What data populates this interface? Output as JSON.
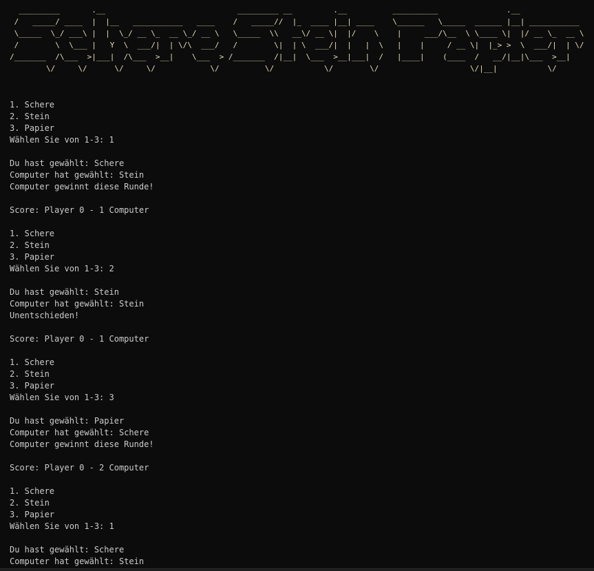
{
  "banner": {
    "ascii_lines": [
      "  _________       .__                             _________ __         .__          __________               .__               ",
      " /   _____/ ____  |  |__   ___________   ____    /   _____//  |_  ____ |__| ____    \\______   \\_____  ______ |__| ___________ ",
      " \\_____  \\_/ ___\\ |  |  \\_/ __ \\_  __ \\_/ __ \\   \\_____  \\\\   __\\/ __ \\|  |/    \\    |     ___/\\__  \\ \\____ \\|  |/ __ \\_  __ \\",
      " /        \\  \\___ |   Y  \\  ___/|  | \\/\\  ___/   /        \\|  | \\  ___/|  |   |  \\   |    |     / __ \\|  |_> >  \\  ___/|  | \\/",
      "/_______  /\\___  >|___|  /\\___  >__|    \\___  > /_______  /|__|  \\___  >__|___|  /   |____|    (____  /   __/|__|\\___  >__|   ",
      "        \\/     \\/      \\/     \\/            \\/          \\/           \\/        \\/                    \\/|__|           \\/       "
    ]
  },
  "output": {
    "lines": [
      "1. Schere",
      "2. Stein",
      "3. Papier",
      "Wählen Sie von 1-3: 1",
      "",
      "Du hast gewählt: Schere",
      "Computer hat gewählt: Stein",
      "Computer gewinnt diese Runde!",
      "",
      "Score: Player 0 - 1 Computer",
      "",
      "1. Schere",
      "2. Stein",
      "3. Papier",
      "Wählen Sie von 1-3: 2",
      "",
      "Du hast gewählt: Stein",
      "Computer hat gewählt: Stein",
      "Unentschieden!",
      "",
      "Score: Player 0 - 1 Computer",
      "",
      "1. Schere",
      "2. Stein",
      "3. Papier",
      "Wählen Sie von 1-3: 3",
      "",
      "Du hast gewählt: Papier",
      "Computer hat gewählt: Schere",
      "Computer gewinnt diese Runde!",
      "",
      "Score: Player 0 - 2 Computer",
      "",
      "1. Schere",
      "2. Stein",
      "3. Papier",
      "Wählen Sie von 1-3: 1",
      "",
      "Du hast gewählt: Schere",
      "Computer hat gewählt: Stein"
    ]
  },
  "colors": {
    "background": "#0c0c0c",
    "text": "#cccccc",
    "banner": "#e8dfb8"
  }
}
